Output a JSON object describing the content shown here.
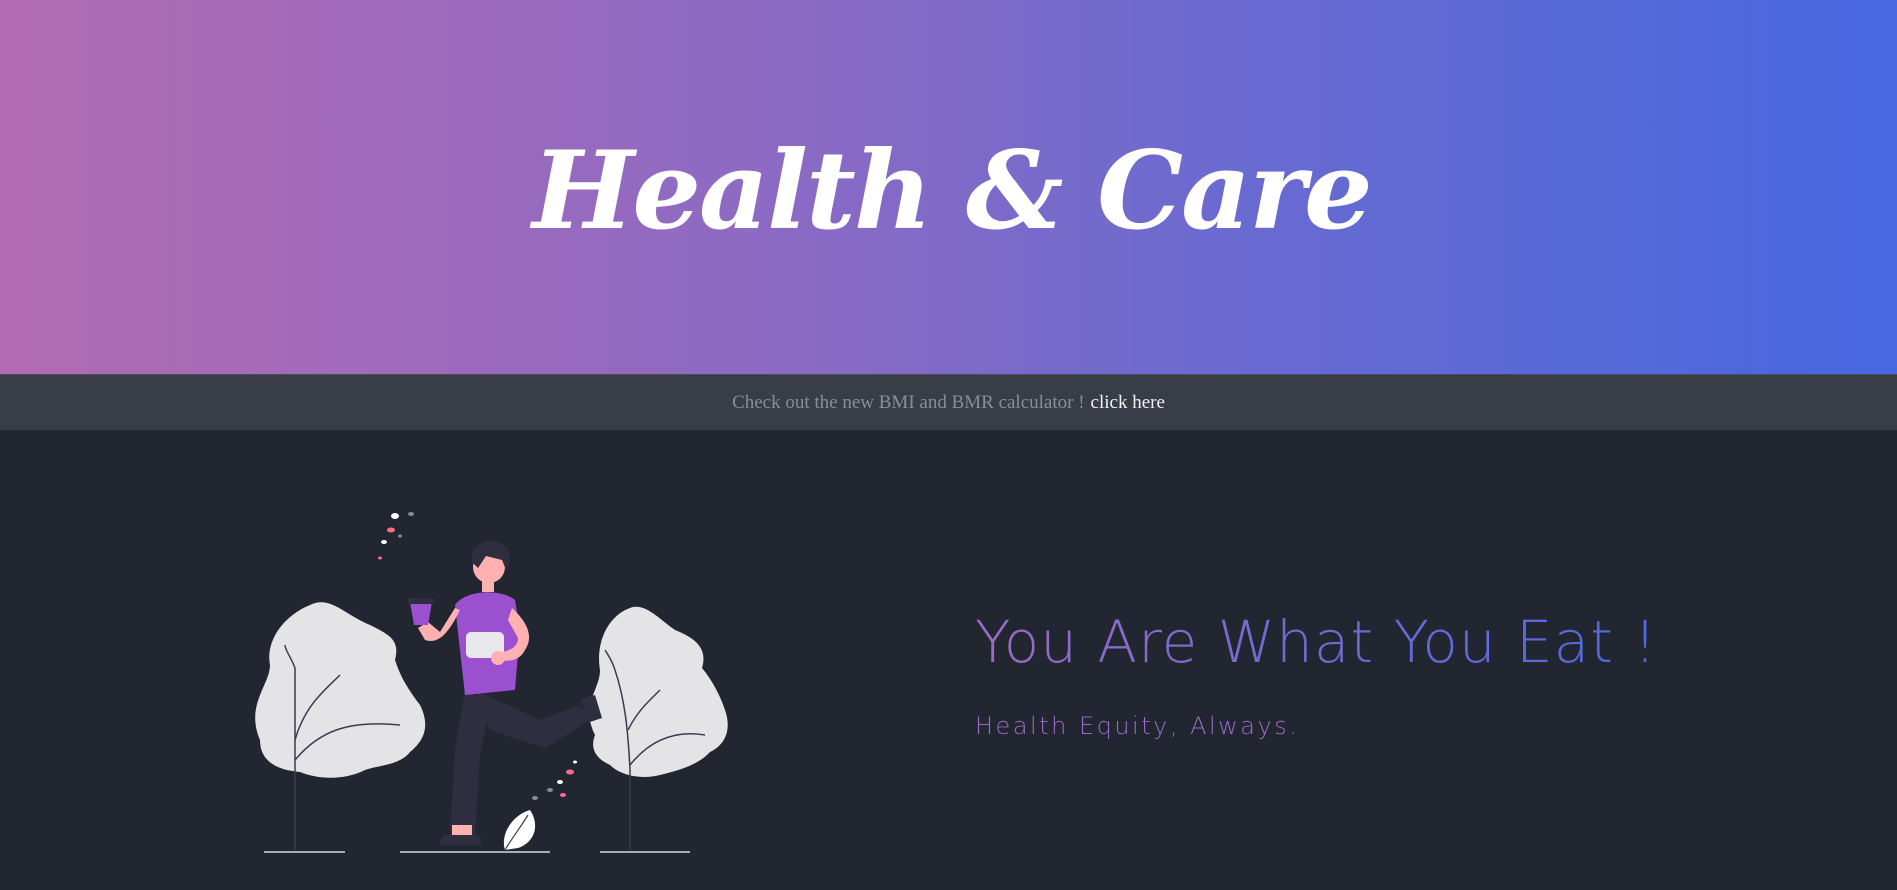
{
  "hero": {
    "title": "Health & Care"
  },
  "announcement": {
    "text": "Check out the new BMI and BMR calculator !",
    "link_label": "click here"
  },
  "main": {
    "tagline": "You Are What You Eat !",
    "subtagline": "Health Equity, Always."
  },
  "colors": {
    "gradient_start": "#b36bb3",
    "gradient_end": "#4668e0",
    "background": "#222631",
    "announce_bar": "#393d47",
    "accent_purple": "#9b50d0",
    "skin": "#ffb0b0"
  },
  "illustration": {
    "icon": "running-person-illustration"
  }
}
